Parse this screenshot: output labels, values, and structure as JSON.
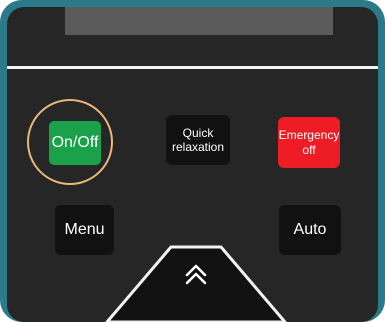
{
  "keypad": {
    "on_off_label": "On/Off",
    "quick_relaxation_line1": "Quick",
    "quick_relaxation_line2": "relaxation",
    "emergency_line1": "Emergency",
    "emergency_line2": "off",
    "menu_label": "Menu",
    "auto_label": "Auto",
    "up_icon": "double-chevron-up-icon"
  },
  "colors": {
    "frame": "#2a7a8a",
    "panel": "#262626",
    "key": "#111111",
    "on_off": "#1aa14a",
    "emergency": "#ee1c24",
    "highlight_ring": "#e8b878"
  }
}
